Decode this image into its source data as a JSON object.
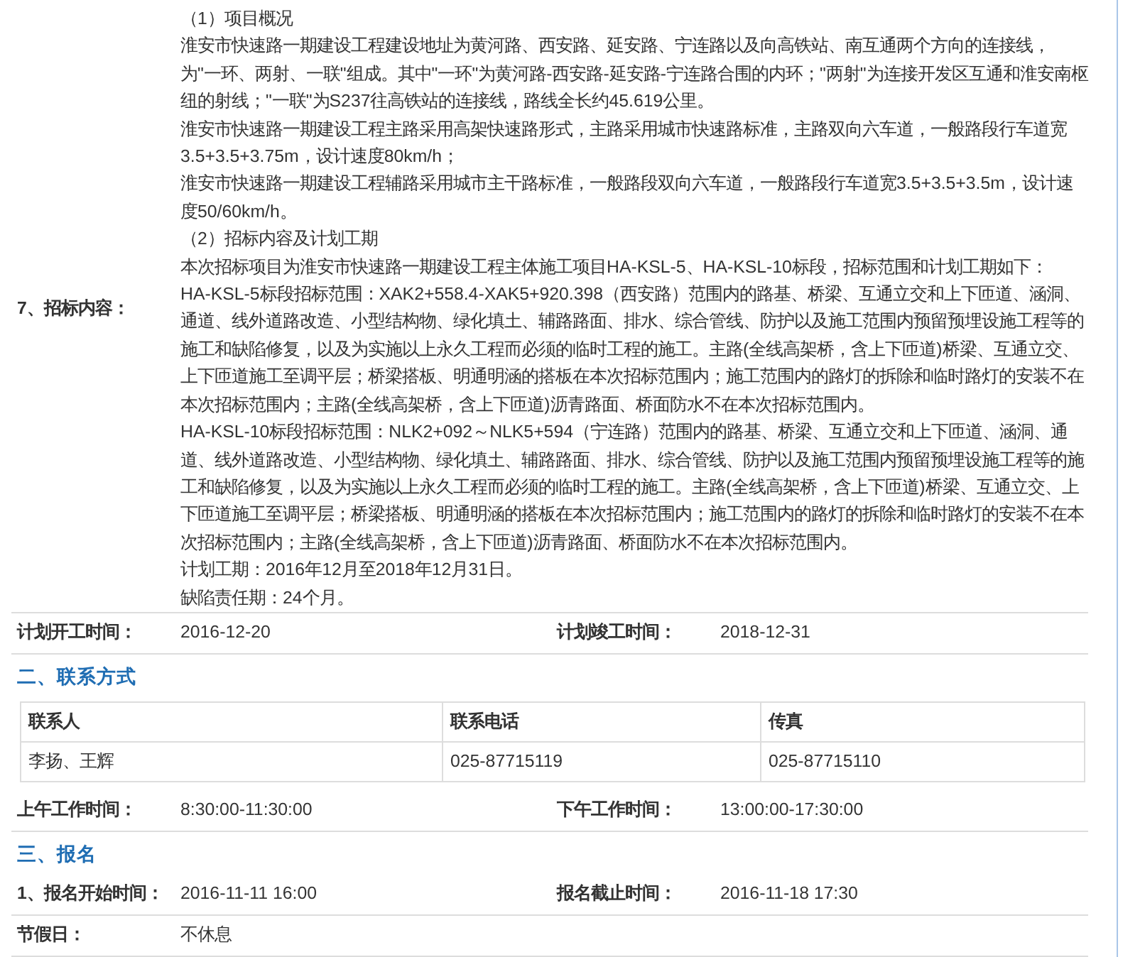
{
  "rows": [
    {
      "kind": "text_block",
      "label": "7、招标内容：",
      "paragraphs": [
        {
          "text": "（1）项目概况"
        },
        {
          "text": "淮安市快速路一期建设工程建设地址为黄河路、西安路、延安路、宁连路以及向高铁站、南互通两个方向的连接线，为\"一环、两射、一联\"组成。其中\"一环\"为黄河路-西安路-延安路-宁连路合围的内环；\"两射\"为连接开发区互通和淮安南枢纽的射线；\"一联\"为S237往高铁站的连接线，路线全长约45.619公里。"
        },
        {
          "text": "淮安市快速路一期建设工程主路采用高架快速路形式，主路采用城市快速路标准，主路双向六车道，一般路段行车道宽3.5+3.5+3.75m，设计速度80km/h；"
        },
        {
          "text": "淮安市快速路一期建设工程辅路采用城市主干路标准，一般路段双向六车道，一般路段行车道宽3.5+3.5+3.5m，设计速度50/60km/h。"
        },
        {
          "text": "（2）招标内容及计划工期"
        },
        {
          "text": "本次招标项目为淮安市快速路一期建设工程主体施工项目HA-KSL-5、HA-KSL-10标段，招标范围和计划工期如下："
        },
        {
          "text": "HA-KSL-5标段招标范围：XAK2+558.4-XAK5+920.398（西安路）范围内的路基、桥梁、互通立交和上下匝道、涵洞、通道、线外道路改造、小型结构物、绿化填土、辅路路面、排水、综合管线、防护以及施工范围内预留预埋设施工程等的施工和缺陷修复，以及为实施以上永久工程而必须的临时工程的施工。主路(全线高架桥，含上下匝道)桥梁、互通立交、上下匝道施工至调平层；桥梁搭板、明通明涵的搭板在本次招标范围内；施工范围内的路灯的拆除和临时路灯的安装不在本次招标范围内；主路(全线高架桥，含上下匝道)沥青路面、桥面防水不在本次招标范围内。"
        },
        {
          "text": "HA-KSL-10标段招标范围：NLK2+092～NLK5+594（宁连路）范围内的路基、桥梁、互通立交和上下匝道、涵洞、通道、线外道路改造、小型结构物、绿化填土、辅路路面、排水、综合管线、防护以及施工范围内预留预埋设施工程等的施工和缺陷修复，以及为实施以上永久工程而必须的临时工程的施工。主路(全线高架桥，含上下匝道)桥梁、互通立交、上下匝道施工至调平层；桥梁搭板、明通明涵的搭板在本次招标范围内；施工范围内的路灯的拆除和临时路灯的安装不在本次招标范围内；主路(全线高架桥，含上下匝道)沥青路面、桥面防水不在本次招标范围内。"
        },
        {
          "text": "计划工期：2016年12月至2018年12月31日。"
        },
        {
          "text": "缺陷责任期：24个月。"
        }
      ]
    },
    {
      "kind": "pair_row",
      "pairs": [
        {
          "label": "计划开工时间：",
          "value": "2016-12-20"
        },
        {
          "label": "计划竣工时间：",
          "value": "2018-12-31"
        }
      ]
    },
    {
      "kind": "heading",
      "text": "二、联系方式"
    },
    {
      "kind": "table",
      "columns": [
        "联系人",
        "联系电话",
        "传真"
      ],
      "rows": [
        [
          "李扬、王辉",
          "025-87715119",
          "025-87715110"
        ]
      ]
    },
    {
      "kind": "pair_row",
      "pairs": [
        {
          "label": "上午工作时间：",
          "value": "8:30:00-11:30:00"
        },
        {
          "label": "下午工作时间：",
          "value": "13:00:00-17:30:00"
        }
      ]
    },
    {
      "kind": "heading",
      "text": "三、报名"
    },
    {
      "kind": "pair_row",
      "pairs": [
        {
          "label": "1、报名开始时间：",
          "value": "2016-11-11 16:00"
        },
        {
          "label": "报名截止时间：",
          "value": "2016-11-18 17:30"
        }
      ]
    },
    {
      "kind": "pair_row",
      "pairs": [
        {
          "label": "节假日：",
          "value": "不休息"
        }
      ]
    }
  ]
}
